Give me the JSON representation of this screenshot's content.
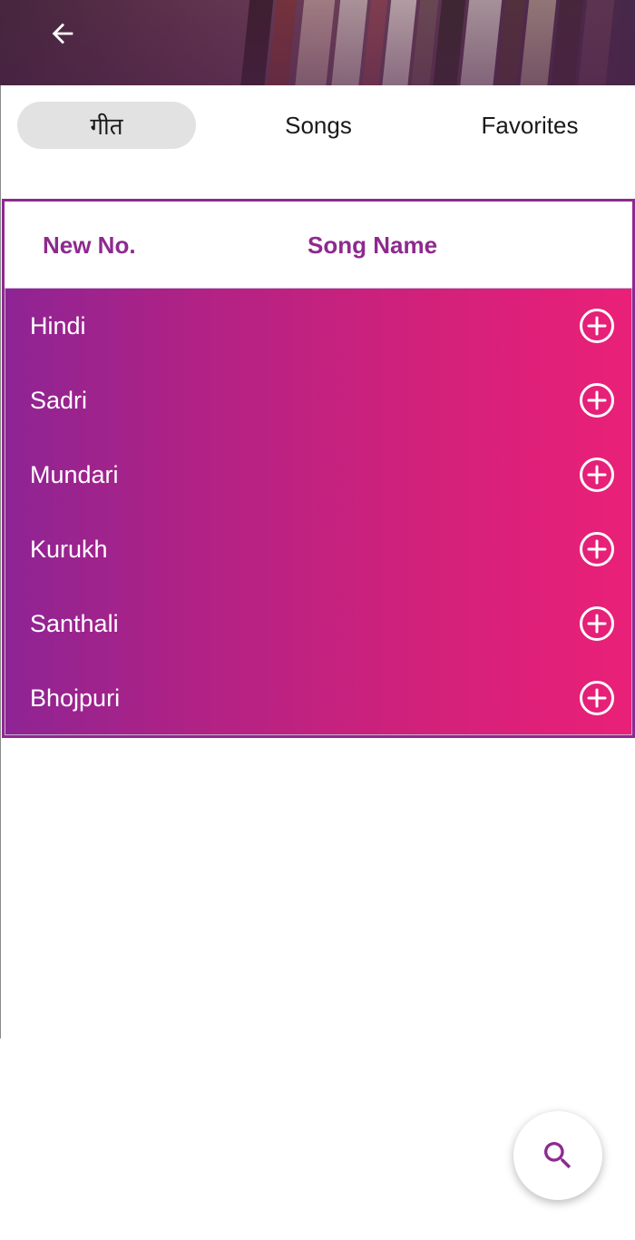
{
  "header": {
    "back_icon": "arrow-left-icon"
  },
  "tabs": [
    {
      "label": "गीत",
      "active": true
    },
    {
      "label": "Songs",
      "active": false
    },
    {
      "label": "Favorites",
      "active": false
    }
  ],
  "table": {
    "columns": [
      "New No.",
      "Song Name"
    ],
    "rows": [
      {
        "label": "Hindi",
        "icon": "plus-circle-icon"
      },
      {
        "label": "Sadri",
        "icon": "plus-circle-icon"
      },
      {
        "label": "Mundari",
        "icon": "plus-circle-icon"
      },
      {
        "label": "Kurukh",
        "icon": "plus-circle-icon"
      },
      {
        "label": "Santhali",
        "icon": "plus-circle-icon"
      },
      {
        "label": "Bhojpuri",
        "icon": "plus-circle-icon"
      }
    ]
  },
  "fab": {
    "icon": "search-icon"
  },
  "colors": {
    "accent": "#8e2a8f",
    "gradient_start": "#8e2494",
    "gradient_end": "#ea2078",
    "active_tab_bg": "#e2e2e2"
  }
}
